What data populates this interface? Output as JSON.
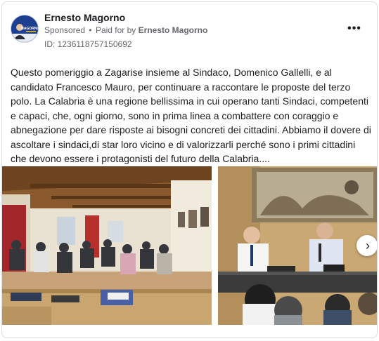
{
  "post": {
    "author": "Ernesto Magorno",
    "sponsored_label": "Sponsored",
    "separator": "•",
    "paid_for_label": "Paid for by",
    "paid_for_name": "Ernesto Magorno",
    "ad_id": "ID: 1236118757150692",
    "text": "Questo pomeriggio a Zagarise insieme al Sindaco, Domenico Gallelli, e al candidato Francesco Mauro, per continuare a raccontare le proposte del terzo polo. La Calabria è una regione bellissima in cui operano tanti Sindaci, competenti e capaci, che, ogni giorno, sono in prima linea a combattere con coraggio e abnegazione per dare risposte ai bisogni concreti dei cittadini. Abbiamo il dovere di ascoltare i sindaci,di star loro vicino e di valorizzarli perché sono i primi cittadini che devono essere i protagonisti del futuro della Calabria....",
    "more_icon": "more-horizontal-icon",
    "more_glyph": "•••",
    "next_icon": "chevron-right-icon",
    "next_glyph": "›"
  },
  "avatar": {
    "text": "MAGORNO",
    "colors": {
      "bg": "#1d3f8f",
      "text": "#ffffff"
    }
  },
  "colors": {
    "text": "#1c1e21",
    "secondary": "#65676b",
    "border": "#dadde1"
  }
}
